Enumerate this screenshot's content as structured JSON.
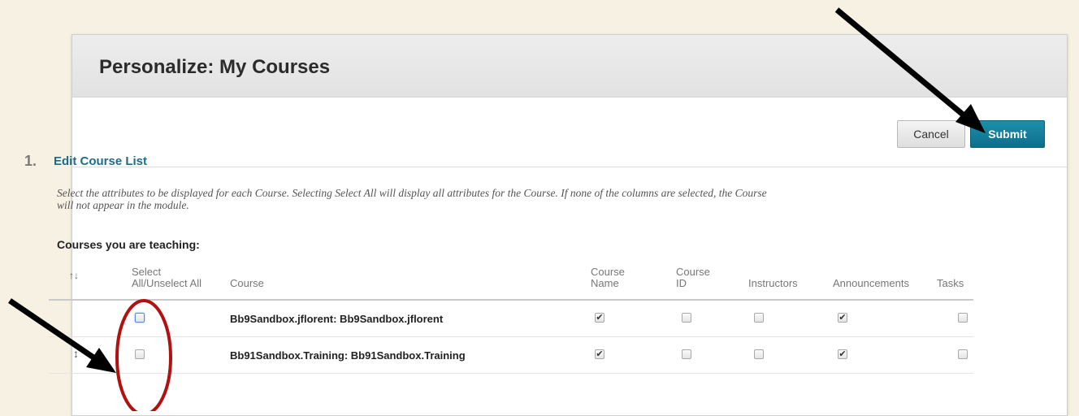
{
  "page": {
    "title": "Personalize: My Courses",
    "cancel_label": "Cancel",
    "submit_label": "Submit"
  },
  "section": {
    "number": "1.",
    "title": "Edit Course List",
    "instructions_line1": "Select the attributes to be displayed for each Course. Selecting Select All will display all attributes for the Course. If none of the columns are selected, the Course",
    "instructions_line2": "will not appear in the module.",
    "subheading": "Courses you are teaching:"
  },
  "table": {
    "sort_icon": "↑↓",
    "headers": {
      "select_all_line1": "Select",
      "select_all_line2": "All/Unselect All",
      "course": "Course",
      "course_name_line1": "Course",
      "course_name_line2": "Name",
      "course_id_line1": "Course",
      "course_id_line2": "ID",
      "instructors": "Instructors",
      "announcements": "Announcements",
      "tasks": "Tasks"
    },
    "rows": [
      {
        "course": "Bb9Sandbox.jflorent: Bb9Sandbox.jflorent",
        "drag_icon": "",
        "select_all": false,
        "course_name": true,
        "course_id": false,
        "instructors": false,
        "announcements": true,
        "tasks": false
      },
      {
        "course": "Bb91Sandbox.Training: Bb91Sandbox.Training",
        "drag_icon": "↕",
        "select_all": false,
        "course_name": true,
        "course_id": false,
        "instructors": false,
        "announcements": true,
        "tasks": false
      }
    ]
  },
  "colors": {
    "accent": "#0c6f8c",
    "link": "#1a6e8a",
    "annotation_circle": "#b01111",
    "annotation_arrow": "#000000"
  },
  "icons": [
    "sort-icon",
    "drag-handle-icon",
    "checkbox-checked",
    "checkbox-unchecked",
    "annotation-arrow",
    "annotation-circle"
  ]
}
